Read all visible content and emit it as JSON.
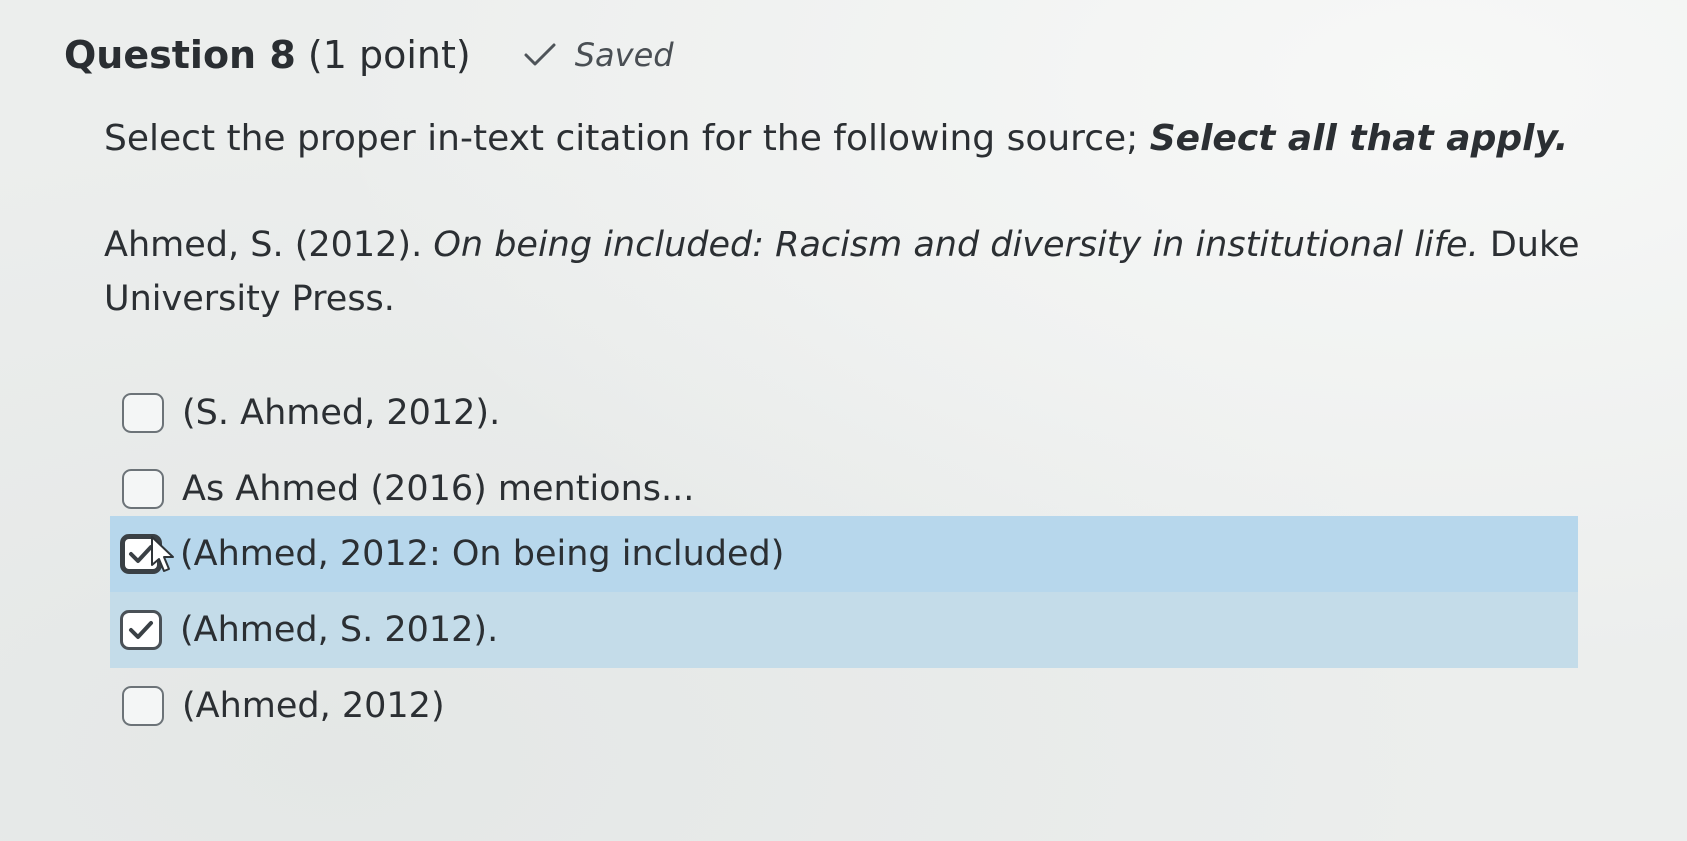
{
  "question": {
    "number_label": "Question 8",
    "points_label": "(1 point)",
    "status_text": "Saved",
    "status_icon": "checkmark-icon"
  },
  "prompt": {
    "text": "Select the proper in-text citation for the following source;",
    "emphasis": "Select all that apply."
  },
  "reference": {
    "authors_year": "Ahmed, S. (2012).",
    "title": "On being included: Racism and diversity in institutional life.",
    "publisher": "Duke University Press."
  },
  "options": [
    {
      "label": "(S. Ahmed, 2012).",
      "checked": false
    },
    {
      "label": "As Ahmed (2016) mentions...",
      "checked": false
    },
    {
      "label": "(Ahmed, 2012: On being included)",
      "checked": true
    },
    {
      "label": "(Ahmed, S. 2012).",
      "checked": true
    },
    {
      "label": "(Ahmed, 2012)",
      "checked": false
    }
  ],
  "colors": {
    "selected_row_primary": "#b7d7ec",
    "selected_row_secondary": "#c4dce9",
    "text": "#2b2f33"
  }
}
